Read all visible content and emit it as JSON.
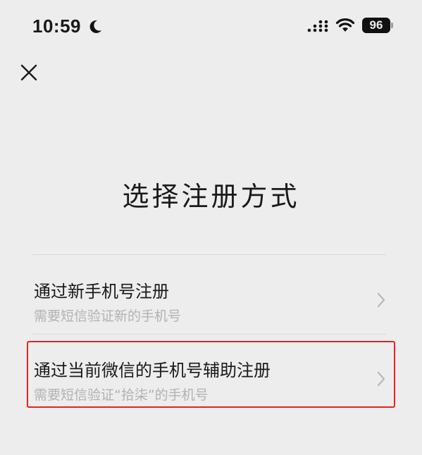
{
  "status_bar": {
    "time": "10:59",
    "battery": "96"
  },
  "page": {
    "title": "选择注册方式"
  },
  "options": [
    {
      "title": "通过新手机号注册",
      "subtitle": "需要短信验证新的手机号"
    },
    {
      "title": "通过当前微信的手机号辅助注册",
      "subtitle": "需要短信验证“拾柒”的手机号"
    }
  ],
  "colors": {
    "background": "#ededed",
    "highlight": "#e8221e",
    "subtitle": "#b2b2b2"
  },
  "icons": [
    "moon-icon",
    "signal-icon",
    "wifi-icon",
    "battery-icon",
    "close-icon",
    "chevron-right-icon"
  ]
}
